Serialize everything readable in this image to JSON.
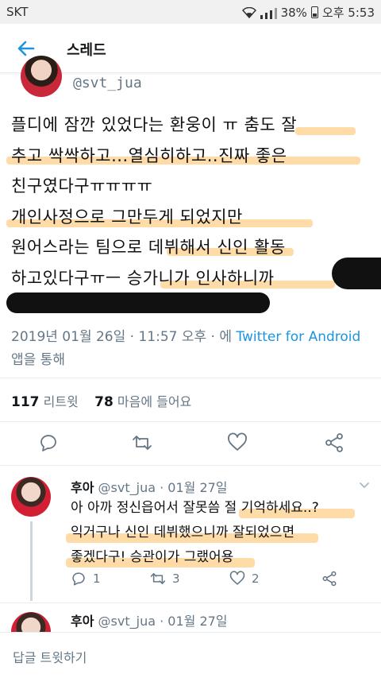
{
  "status_bar": {
    "carrier": "SKT",
    "battery": "38%",
    "time": "오후 5:53"
  },
  "header": {
    "title": "스레드"
  },
  "tweet": {
    "handle": "@svt_jua",
    "lines": [
      "플디에 잠깐 있었다는 환웅이 ㅠ 춤도 잘",
      "추고 싹싹하고...열심히하고..진짜 좋은",
      "친구였다구ㅠㅠㅠㅠ",
      " 개인사정으로 그만두게 되었지만",
      "원어스라는 팀으로 데뷔해서 신인 활동",
      "하고있다구ㅠㅡ 승가니가 인사하니까"
    ],
    "date_time": "2019년 01월 26일 · 11:57 오후 · 에 ",
    "source_link": "Twitter for Android",
    "source_suffix": " 앱을 통해",
    "retweet_count": "117",
    "retweet_label": "리트윗",
    "like_count": "78",
    "like_label": "마음에 들어요"
  },
  "reply": {
    "name": "후아",
    "handle": "@svt_jua",
    "date": "· 01월 27일",
    "lines": [
      "아 아까 정신읍어서 잘못씀 절 기억하세요..?",
      "익거구나 신인 데뷔했으니까 잘되었으면",
      "좋겠다구! 승관이가 그랬어용"
    ],
    "reply_count": "1",
    "retweet_count": "3",
    "like_count": "2"
  },
  "reply2": {
    "name": "후아",
    "handle": "@svt_jua",
    "date": "· 01월 27일"
  },
  "compose": {
    "placeholder": "답글 트윗하기"
  },
  "colors": {
    "accent": "#1b95e0",
    "highlight": "#ffcf8a",
    "muted": "#657786"
  }
}
